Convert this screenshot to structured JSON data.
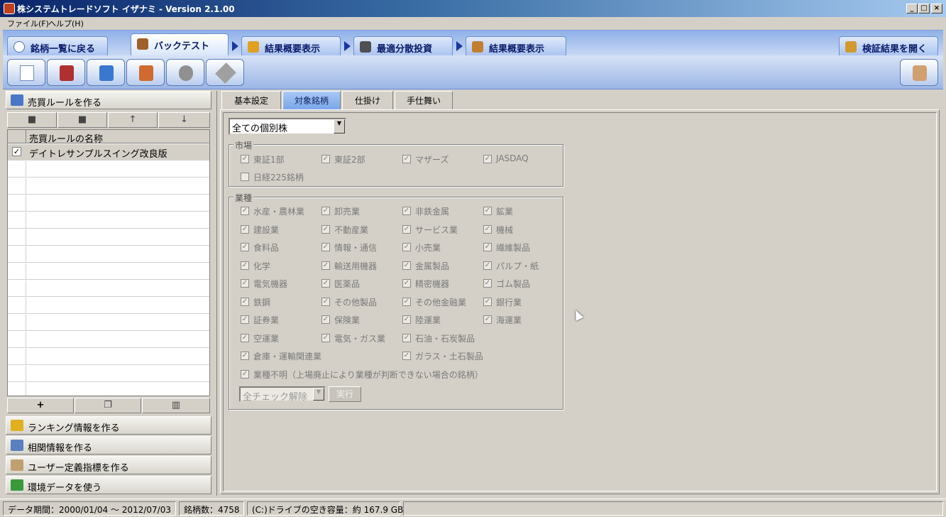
{
  "window": {
    "title": "株システムトレードソフト イザナミ - Version 2.1.00",
    "controls": [
      "_",
      "□",
      "×"
    ]
  },
  "menu": [
    "ファイル(F)",
    "ヘルプ(H)"
  ],
  "nav_tabs": [
    {
      "label": "銘柄一覧に戻る",
      "icon": "eye-icon"
    },
    {
      "label": "バックテスト",
      "icon": "bag-icon",
      "active": true
    },
    {
      "label": "結果概要表示",
      "icon": "coins-icon"
    },
    {
      "label": "最適分散投資",
      "icon": "calculator-icon"
    },
    {
      "label": "結果概要表示",
      "icon": "chart-icon"
    },
    {
      "label": "検証結果を開く",
      "icon": "open-results-icon"
    }
  ],
  "toolbar": {
    "buttons": [
      "new-file-icon",
      "cash-register-icon",
      "export-icon",
      "import-icon",
      "settings-tools-icon",
      "tools-icon"
    ],
    "right_button": "print-icon"
  },
  "left": {
    "rules_header": "売買ルールを作る",
    "column_header": "売買ルールの名称",
    "rules": [
      {
        "name": "デイトレサンプルスイング改良版",
        "checked": true
      }
    ],
    "sections": [
      "ランキング情報を作る",
      "相関情報を作る",
      "ユーザー定義指標を作る",
      "環境データを使う"
    ],
    "mini_top": [
      "save-icon",
      "save-as-icon",
      "up-arrow-icon",
      "down-arrow-icon"
    ],
    "mini_bottom": [
      "+",
      "copy-icon",
      "trash-icon"
    ]
  },
  "sub_tabs": [
    "基本設定",
    "対象銘柄",
    "仕掛け",
    "手仕舞い"
  ],
  "stock_select": "全ての個別株",
  "market": {
    "title": "市場",
    "items": [
      "東証1部",
      "東証2部",
      "マザーズ",
      "JASDAQ"
    ],
    "nikkei": "日経225銘柄"
  },
  "industry": {
    "title": "業種",
    "rows": [
      [
        "水産・農林業",
        "卸売業",
        "非鉄金属",
        "鉱業"
      ],
      [
        "建設業",
        "不動産業",
        "サービス業",
        "機械"
      ],
      [
        "食料品",
        "情報・通信",
        "小売業",
        "繊維製品"
      ],
      [
        "化学",
        "輸送用機器",
        "金属製品",
        "パルプ・紙"
      ],
      [
        "電気機器",
        "医薬品",
        "精密機器",
        "ゴム製品"
      ],
      [
        "鉄鋼",
        "その他製品",
        "その他金融業",
        "銀行業"
      ],
      [
        "証券業",
        "保険業",
        "陸運業",
        "海運業"
      ],
      [
        "空運業",
        "電気・ガス業",
        "石油・石炭製品",
        ""
      ],
      [
        "倉庫・運輸関連業",
        "",
        "ガラス・土石製品",
        ""
      ]
    ],
    "unknown": "業種不明（上場廃止により業種が判断できない場合の銘柄）",
    "bulk_select": "全チェック解除",
    "run": "実行"
  },
  "status": {
    "period": "データ期間：2000/01/04 〜 2012/07/03",
    "count": "銘柄数：4758",
    "disk": "(C:)ドライブの空き容量：約 167.9 GB"
  }
}
